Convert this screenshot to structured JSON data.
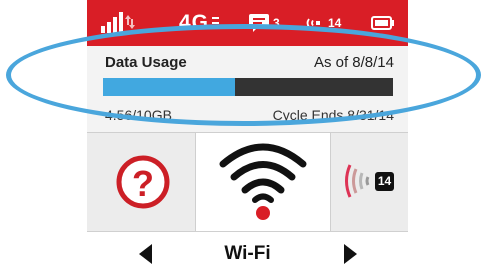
{
  "colors": {
    "status_bar": "#d91e26",
    "accent_blue": "#41a8e0",
    "track": "#333333",
    "highlight": "#4aa6dc"
  },
  "status_bar": {
    "signal_icon": "signal-strength-icon",
    "network_label": "4G",
    "messages_count": "3",
    "connected_devices_count": "14",
    "battery_icon": "battery-icon"
  },
  "usage": {
    "title": "Data Usage",
    "as_of": "As of 8/8/14",
    "amount": "4.56/10GB",
    "used_fraction": 0.456,
    "cycle_ends": "Cycle Ends 8/31/14"
  },
  "tiles": {
    "help_icon": "help-icon",
    "wifi_icon": "wifi-icon",
    "devices_icon": "connected-devices-icon",
    "devices_count": "14"
  },
  "nav": {
    "label": "Wi-Fi"
  }
}
